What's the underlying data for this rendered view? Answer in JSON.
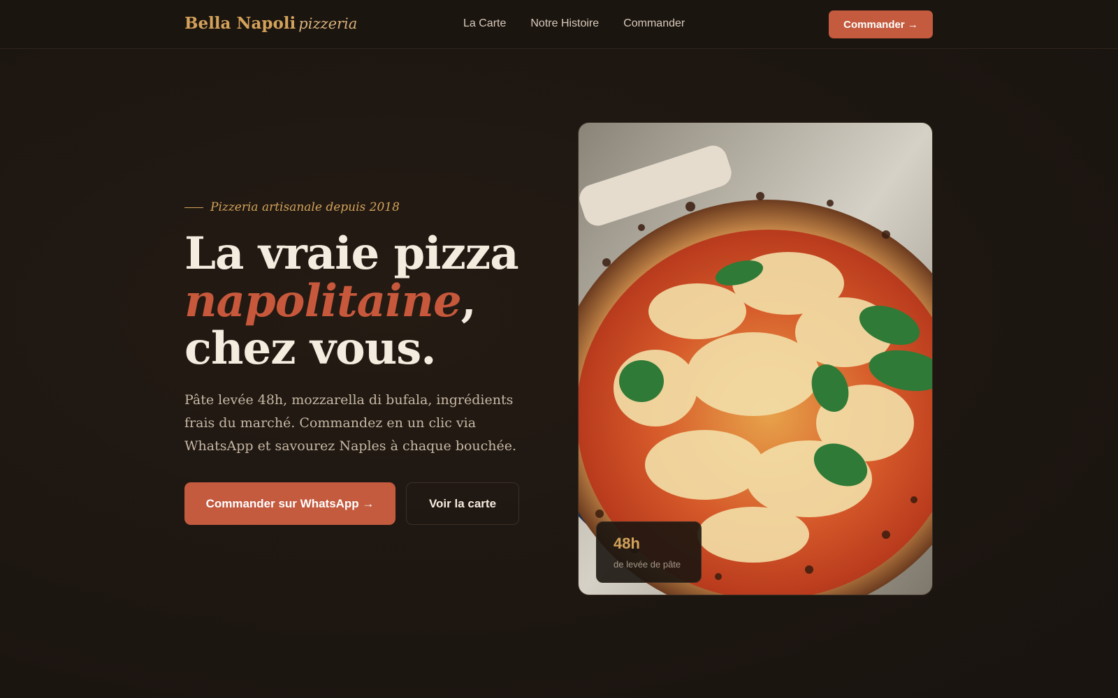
{
  "brand": {
    "name": "Bella Napoli",
    "sub": "pizzeria"
  },
  "nav": {
    "items": [
      "La Carte",
      "Notre Histoire",
      "Commander"
    ]
  },
  "header_cta": "Commander →",
  "hero": {
    "eyebrow": "Pizzeria artisanale depuis 2018",
    "headline_start": "La vraie pizza ",
    "headline_accent": "napolitaine",
    "headline_end": ", chez vous.",
    "description": "Pâte levée 48h, mozzarella di bufala, ingrédients frais du marché. Commandez en un clic via WhatsApp et savourez Naples à chaque bouchée.",
    "primary_button": "Commander sur WhatsApp →",
    "secondary_button": "Voir la carte"
  },
  "stat": {
    "value": "48h",
    "label": "de levée de pâte"
  },
  "colors": {
    "accent": "#c45a3e",
    "gold": "#d4a25a",
    "background": "#1d1611"
  }
}
